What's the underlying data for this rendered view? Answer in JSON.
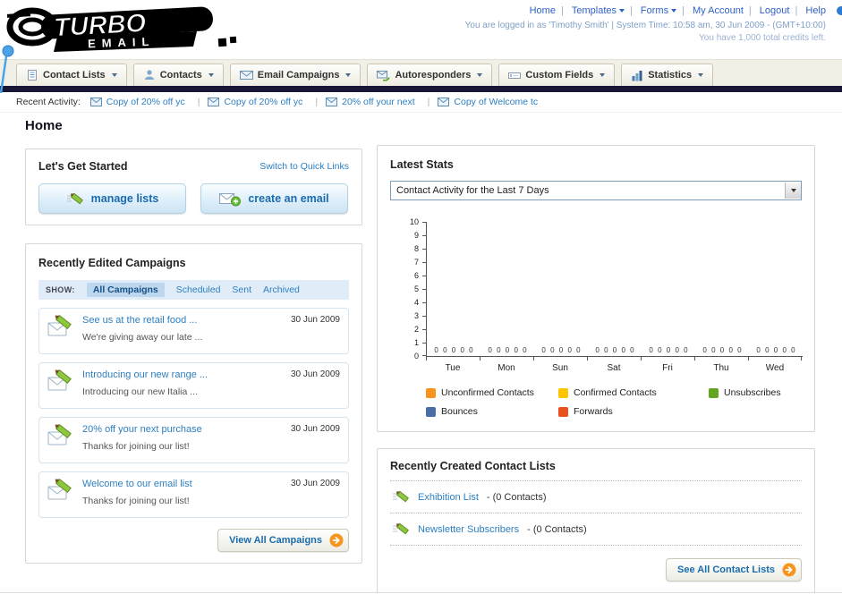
{
  "header": {
    "logo": {
      "top": "TURBO",
      "bottom": "EMAIL"
    },
    "nav_links": [
      {
        "label": "Home",
        "dropdown": false
      },
      {
        "label": "Templates",
        "dropdown": true
      },
      {
        "label": "Forms",
        "dropdown": true
      },
      {
        "label": "My Account",
        "dropdown": false
      },
      {
        "label": "Logout",
        "dropdown": false
      },
      {
        "label": "Help",
        "dropdown": false
      }
    ],
    "login_status": "You are logged in as 'Timothy Smith' | System Time: 10:58 am, 30 Jun 2009 - (GMT+10:00)",
    "credits_note": "You have 1,000 total credits left."
  },
  "main_nav": {
    "tabs": [
      {
        "label": "Contact Lists",
        "icon": "contact-lists-icon"
      },
      {
        "label": "Contacts",
        "icon": "contacts-icon"
      },
      {
        "label": "Email Campaigns",
        "icon": "email-campaigns-icon"
      },
      {
        "label": "Autoresponders",
        "icon": "autoresponders-icon"
      },
      {
        "label": "Custom Fields",
        "icon": "custom-fields-icon"
      },
      {
        "label": "Statistics",
        "icon": "statistics-icon"
      }
    ]
  },
  "recent_activity": {
    "label": "Recent Activity:",
    "items": [
      {
        "label": "Copy of 20% off yc"
      },
      {
        "label": "Copy of 20% off yc"
      },
      {
        "label": "20% off your next"
      },
      {
        "label": "Copy of Welcome tc"
      }
    ]
  },
  "page": {
    "title": "Home"
  },
  "get_started": {
    "title": "Let's Get Started",
    "switch_link": "Switch to Quick Links",
    "buttons": [
      {
        "label": "manage lists",
        "icon": "pencil-icon"
      },
      {
        "label": "create an email",
        "icon": "new-email-icon"
      }
    ]
  },
  "campaigns": {
    "title": "Recently Edited Campaigns",
    "show_label": "SHOW:",
    "filters": [
      {
        "label": "All Campaigns",
        "selected": true
      },
      {
        "label": "Scheduled",
        "selected": false
      },
      {
        "label": "Sent",
        "selected": false
      },
      {
        "label": "Archived",
        "selected": false
      }
    ],
    "items": [
      {
        "title": "See us at the retail food ...",
        "subtitle": "We're giving away our late ...",
        "date": "30 Jun 2009"
      },
      {
        "title": "Introducing our new range ...",
        "subtitle": "Introducing our new Italia ...",
        "date": "30 Jun 2009"
      },
      {
        "title": "20% off your next purchase",
        "subtitle": "Thanks for joining our list!",
        "date": "30 Jun 2009"
      },
      {
        "title": "Welcome to our email list",
        "subtitle": "Thanks for joining our list!",
        "date": "30 Jun 2009"
      }
    ],
    "view_all_label": "View All Campaigns"
  },
  "stats": {
    "title": "Latest Stats",
    "dropdown_value": "Contact Activity for the Last 7 Days"
  },
  "chart_data": {
    "type": "bar",
    "title": "Contact Activity for the Last 7 Days",
    "categories": [
      "Tue",
      "Mon",
      "Sun",
      "Sat",
      "Fri",
      "Thu",
      "Wed"
    ],
    "series": [
      {
        "name": "Unconfirmed Contacts",
        "color": "#f7941d",
        "values": [
          0,
          0,
          0,
          0,
          0,
          0,
          0
        ]
      },
      {
        "name": "Confirmed Contacts",
        "color": "#fdc500",
        "values": [
          0,
          0,
          0,
          0,
          0,
          0,
          0
        ]
      },
      {
        "name": "Unsubscribes",
        "color": "#61a521",
        "values": [
          0,
          0,
          0,
          0,
          0,
          0,
          0
        ]
      },
      {
        "name": "Bounces",
        "color": "#4a6da7",
        "values": [
          0,
          0,
          0,
          0,
          0,
          0,
          0
        ]
      },
      {
        "name": "Forwards",
        "color": "#e8501e",
        "values": [
          0,
          0,
          0,
          0,
          0,
          0,
          0
        ]
      }
    ],
    "ylim": [
      0,
      10
    ],
    "yticks": [
      "10",
      "9",
      "8",
      "7",
      "6",
      "5",
      "4",
      "3",
      "2",
      "1",
      "0"
    ],
    "value_labels": [
      "0 0 0 0 0",
      "0 0 0 0 0",
      "0 0 0 0 0",
      "0 0 0 0 0",
      "0 0 0 0 0",
      "0 0 0 0 0",
      "0 0 0 0 0"
    ],
    "grid": false,
    "legend_position": "bottom"
  },
  "contact_lists": {
    "title": "Recently Created Contact Lists",
    "items": [
      {
        "name": "Exhibition List",
        "detail": "- (0 Contacts)"
      },
      {
        "name": "Newsletter Subscribers",
        "detail": "- (0 Contacts)"
      }
    ],
    "see_all_label": "See All Contact Lists"
  }
}
